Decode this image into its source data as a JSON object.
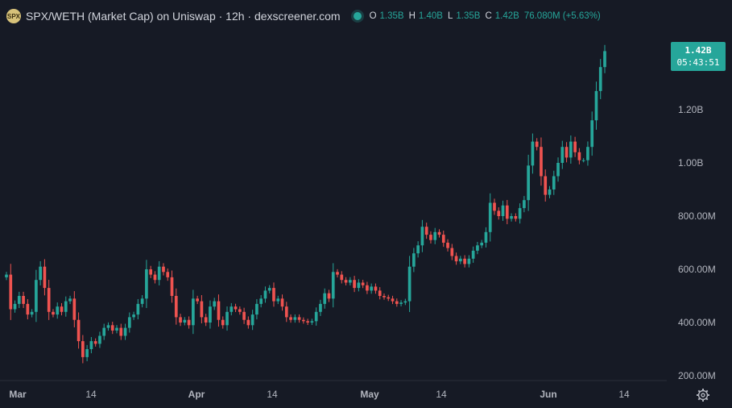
{
  "legend": {
    "title": "SPX/WETH (Market Cap) on Uniswap · 12h · dexscreener.com",
    "logo_text": "SPX",
    "o_label": "O",
    "o_value": "1.35B",
    "h_label": "H",
    "h_value": "1.40B",
    "l_label": "L",
    "l_value": "1.35B",
    "c_label": "C",
    "c_value": "1.42B",
    "change": "76.080M (+5.63%)"
  },
  "price_badge": {
    "value": "1.42B",
    "countdown": "05:43:51"
  },
  "colors": {
    "background": "#161a25",
    "up": "#26a69a",
    "down": "#ef5350",
    "text": "#d1d4dc",
    "axis_text": "#b2b5be"
  },
  "chart_data": {
    "type": "candlestick",
    "title": "SPX/WETH (Market Cap) on Uniswap · 12h · dexscreener.com",
    "interval": "12h",
    "x_ticks": [
      "Mar",
      "14",
      "Apr",
      "14",
      "May",
      "14",
      "Jun",
      "14"
    ],
    "y_ticks": [
      "200.00M",
      "400.00M",
      "600.00M",
      "800.00M",
      "1.00B",
      "1.20B"
    ],
    "y_tick_values": [
      200,
      400,
      600,
      800,
      1000,
      1200
    ],
    "y_unit": "M",
    "ylim": [
      178,
      1460
    ],
    "last_price": 1420,
    "grid": false,
    "points": [
      [
        570,
        580
      ],
      [
        580,
        450
      ],
      [
        450,
        470
      ],
      [
        470,
        500
      ],
      [
        500,
        470
      ],
      [
        470,
        430
      ],
      [
        430,
        440
      ],
      [
        440,
        560
      ],
      [
        560,
        610
      ],
      [
        610,
        530
      ],
      [
        530,
        440
      ],
      [
        440,
        430
      ],
      [
        430,
        460
      ],
      [
        460,
        440
      ],
      [
        440,
        480
      ],
      [
        480,
        490
      ],
      [
        490,
        410
      ],
      [
        410,
        330
      ],
      [
        330,
        270
      ],
      [
        270,
        300
      ],
      [
        300,
        330
      ],
      [
        330,
        320
      ],
      [
        320,
        350
      ],
      [
        350,
        380
      ],
      [
        380,
        390
      ],
      [
        390,
        370
      ],
      [
        370,
        380
      ],
      [
        380,
        350
      ],
      [
        350,
        380
      ],
      [
        380,
        420
      ],
      [
        420,
        430
      ],
      [
        430,
        470
      ],
      [
        470,
        490
      ],
      [
        490,
        600
      ],
      [
        600,
        580
      ],
      [
        580,
        560
      ],
      [
        560,
        610
      ],
      [
        610,
        590
      ],
      [
        590,
        570
      ],
      [
        570,
        500
      ],
      [
        500,
        420
      ],
      [
        420,
        400
      ],
      [
        400,
        410
      ],
      [
        410,
        390
      ],
      [
        390,
        490
      ],
      [
        490,
        480
      ],
      [
        480,
        420
      ],
      [
        420,
        400
      ],
      [
        400,
        460
      ],
      [
        460,
        480
      ],
      [
        480,
        410
      ],
      [
        410,
        390
      ],
      [
        390,
        440
      ],
      [
        440,
        460
      ],
      [
        460,
        450
      ],
      [
        450,
        440
      ],
      [
        440,
        410
      ],
      [
        410,
        390
      ],
      [
        390,
        430
      ],
      [
        430,
        470
      ],
      [
        470,
        490
      ],
      [
        490,
        520
      ],
      [
        520,
        530
      ],
      [
        530,
        480
      ],
      [
        480,
        490
      ],
      [
        490,
        460
      ],
      [
        460,
        420
      ],
      [
        420,
        410
      ],
      [
        410,
        420
      ],
      [
        420,
        410
      ],
      [
        410,
        405
      ],
      [
        405,
        400
      ],
      [
        400,
        405
      ],
      [
        405,
        440
      ],
      [
        440,
        470
      ],
      [
        470,
        510
      ],
      [
        510,
        490
      ],
      [
        490,
        590
      ],
      [
        590,
        580
      ],
      [
        580,
        560
      ],
      [
        560,
        550
      ],
      [
        550,
        560
      ],
      [
        560,
        530
      ],
      [
        530,
        550
      ],
      [
        550,
        540
      ],
      [
        540,
        520
      ],
      [
        520,
        535
      ],
      [
        535,
        520
      ],
      [
        520,
        500
      ],
      [
        500,
        495
      ],
      [
        495,
        490
      ],
      [
        490,
        480
      ],
      [
        480,
        470
      ],
      [
        470,
        475
      ],
      [
        475,
        480
      ],
      [
        480,
        610
      ],
      [
        610,
        660
      ],
      [
        660,
        690
      ],
      [
        690,
        760
      ],
      [
        760,
        730
      ],
      [
        730,
        710
      ],
      [
        710,
        740
      ],
      [
        740,
        730
      ],
      [
        730,
        700
      ],
      [
        700,
        680
      ],
      [
        680,
        650
      ],
      [
        650,
        630
      ],
      [
        630,
        640
      ],
      [
        640,
        620
      ],
      [
        620,
        640
      ],
      [
        640,
        670
      ],
      [
        670,
        690
      ],
      [
        690,
        700
      ],
      [
        700,
        740
      ],
      [
        740,
        850
      ],
      [
        850,
        820
      ],
      [
        820,
        800
      ],
      [
        800,
        840
      ],
      [
        840,
        790
      ],
      [
        790,
        800
      ],
      [
        800,
        790
      ],
      [
        790,
        830
      ],
      [
        830,
        860
      ],
      [
        860,
        990
      ],
      [
        990,
        1080
      ],
      [
        1080,
        1060
      ],
      [
        1060,
        950
      ],
      [
        950,
        880
      ],
      [
        880,
        900
      ],
      [
        900,
        950
      ],
      [
        950,
        1000
      ],
      [
        1000,
        1060
      ],
      [
        1060,
        1020
      ],
      [
        1020,
        1080
      ],
      [
        1080,
        1040
      ],
      [
        1040,
        1010
      ],
      [
        1010,
        1010
      ],
      [
        1010,
        1060
      ],
      [
        1060,
        1160
      ],
      [
        1160,
        1270
      ],
      [
        1270,
        1360
      ],
      [
        1360,
        1420
      ]
    ]
  }
}
